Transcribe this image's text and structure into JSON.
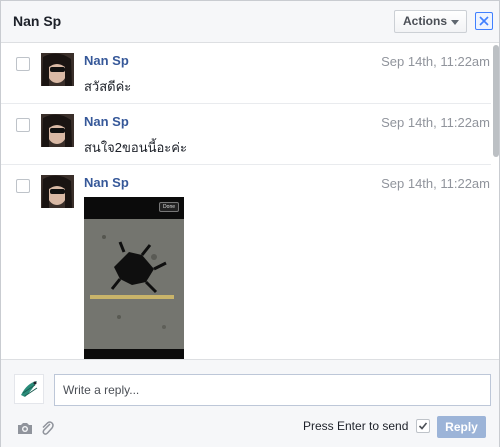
{
  "header": {
    "title": "Nan Sp",
    "actions_label": "Actions",
    "close_icon": "close-icon"
  },
  "messages": [
    {
      "sender": "Nan Sp",
      "time": "Sep 14th, 11:22am",
      "text": "สวัสดีค่ะ"
    },
    {
      "sender": "Nan Sp",
      "time": "Sep 14th, 11:22am",
      "text": "สนใจ2ขอนนี้อะค่ะ"
    },
    {
      "sender": "Nan Sp",
      "time": "Sep 14th, 11:22am",
      "photo_button": "Done"
    }
  ],
  "composer": {
    "placeholder": "Write a reply...",
    "press_enter_label": "Press Enter to send",
    "press_enter_checked": true,
    "reply_label": "Reply"
  },
  "colors": {
    "link": "#365899",
    "reply_button": "#9cb4d8",
    "header_bg": "#f6f7f9"
  }
}
